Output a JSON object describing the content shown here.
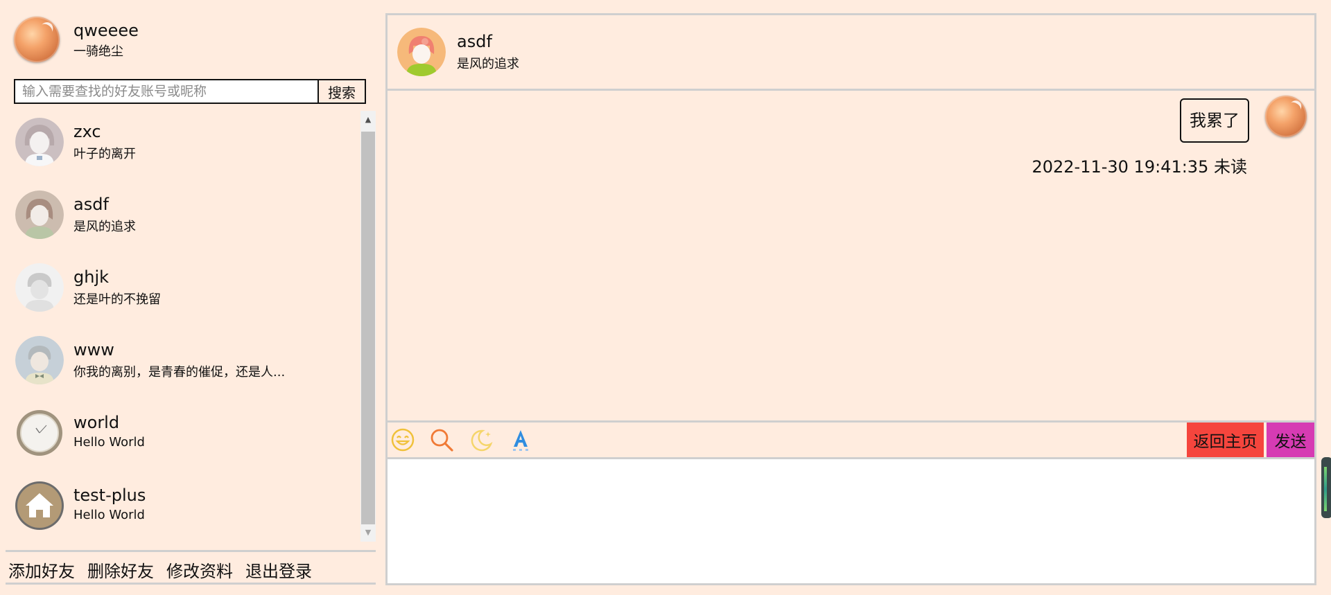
{
  "colors": {
    "background": "#ffecdf",
    "border": "#cfcfcf",
    "back_button": "#f5453d",
    "send_button": "#d63bb3",
    "scrollbar_thumb": "#c1c1c1"
  },
  "me": {
    "name": "qweeee",
    "signature": "一骑绝尘",
    "avatar_icon": "orange-orb-avatar"
  },
  "search": {
    "placeholder": "输入需要查找的好友账号或昵称",
    "button_label": "搜索"
  },
  "friends": [
    {
      "name": "zxc",
      "signature": "叶子的离开",
      "avatar_icon": "girl-avatar"
    },
    {
      "name": "asdf",
      "signature": "是风的追求",
      "avatar_icon": "girl-avatar"
    },
    {
      "name": "ghjk",
      "signature": "还是叶的不挽留",
      "avatar_icon": "boy-avatar"
    },
    {
      "name": "www",
      "signature": "你我的离别，是青春的催促，还是人...",
      "avatar_icon": "boy-bowtie-avatar"
    },
    {
      "name": "world",
      "signature": "Hello World",
      "avatar_icon": "clock-avatar"
    },
    {
      "name": "test-plus",
      "signature": "Hello World",
      "avatar_icon": "home-avatar"
    }
  ],
  "bottom_actions": {
    "add_friend": "添加好友",
    "delete_friend": "删除好友",
    "edit_profile": "修改资料",
    "logout": "退出登录"
  },
  "chat": {
    "peer": {
      "name": "asdf",
      "signature": "是风的追求",
      "avatar_icon": "girl-avatar"
    },
    "messages": [
      {
        "text": "我累了",
        "timestamp": "2022-11-30 19:41:35",
        "status": "未读",
        "sender": "me"
      }
    ],
    "toolbar": {
      "icons": [
        "emoji-icon",
        "search-icon",
        "moon-icon",
        "font-icon"
      ],
      "back_label": "返回主页",
      "send_label": "发送"
    },
    "compose_value": ""
  }
}
